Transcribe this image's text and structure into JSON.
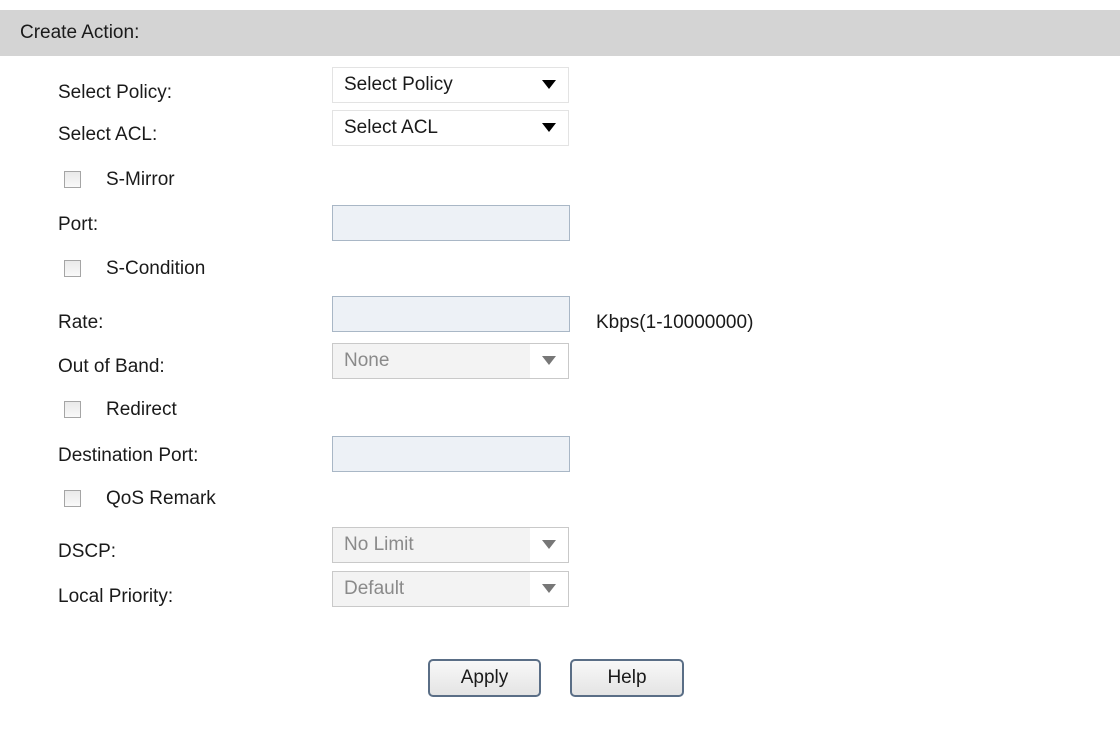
{
  "section": {
    "title": "Create Action:"
  },
  "fields": {
    "select_policy": {
      "label": "Select Policy:",
      "value": "Select Policy"
    },
    "select_acl": {
      "label": "Select ACL:",
      "value": "Select ACL"
    },
    "s_mirror": {
      "label": "S-Mirror",
      "checked": false
    },
    "port": {
      "label": "Port:",
      "value": ""
    },
    "s_condition": {
      "label": "S-Condition",
      "checked": false
    },
    "rate": {
      "label": "Rate:",
      "value": "",
      "unit": "Kbps(1-10000000)"
    },
    "out_of_band": {
      "label": "Out of Band:",
      "value": "None"
    },
    "redirect": {
      "label": "Redirect",
      "checked": false
    },
    "destination_port": {
      "label": "Destination Port:",
      "value": ""
    },
    "qos_remark": {
      "label": "QoS Remark",
      "checked": false
    },
    "dscp": {
      "label": "DSCP:",
      "value": "No Limit"
    },
    "local_priority": {
      "label": "Local Priority:",
      "value": "Default"
    }
  },
  "buttons": {
    "apply": "Apply",
    "help": "Help"
  },
  "colors": {
    "header_bg": "#d4d4d4",
    "input_bg": "#edf1f6",
    "input_border": "#a9b7c6",
    "button_border": "#5a6e86",
    "disabled_text": "#8a8a8a"
  },
  "icons": {
    "dropdown": "triangle-down-icon",
    "checkbox": "unchecked-checkbox-icon"
  }
}
